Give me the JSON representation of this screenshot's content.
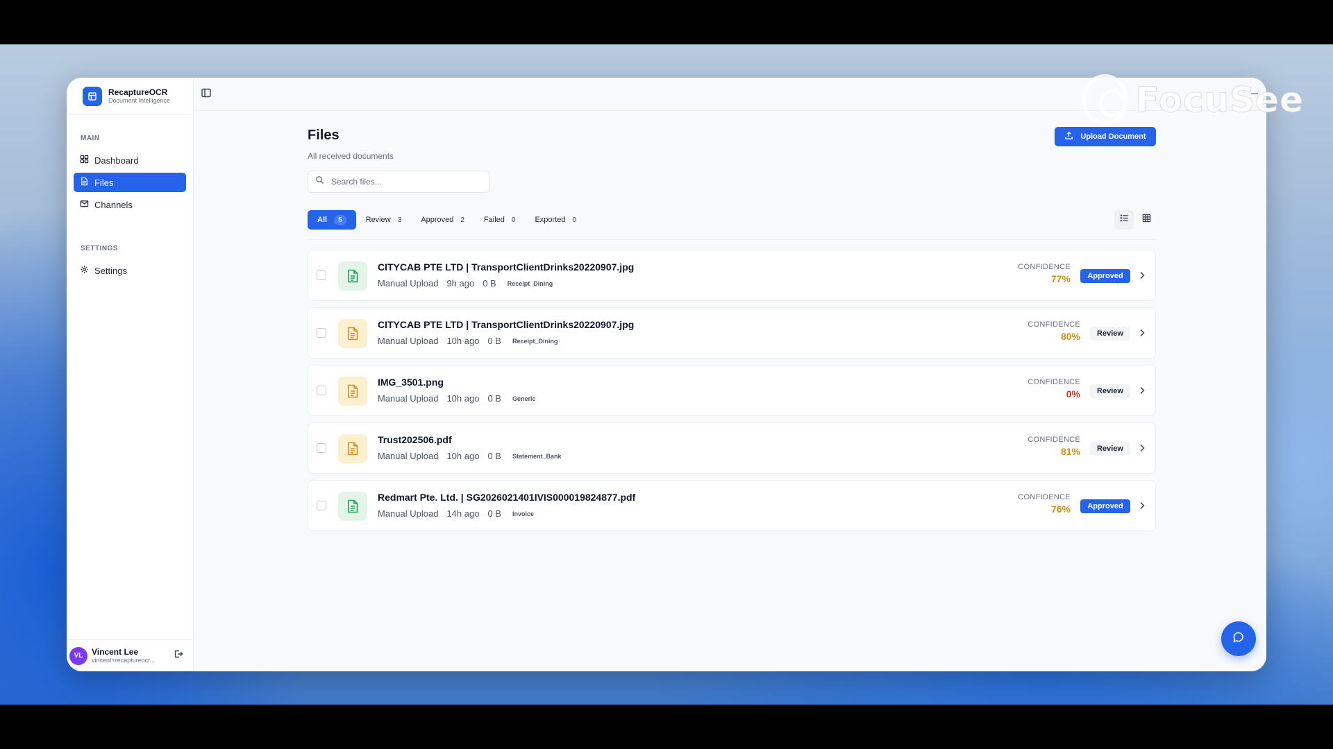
{
  "brand": {
    "name": "RecaptureOCR",
    "subtitle": "Document Intelligence"
  },
  "sidebar": {
    "main_label": "MAIN",
    "main_items": [
      {
        "label": "Dashboard",
        "icon": "grid-icon"
      },
      {
        "label": "Files",
        "icon": "file-icon",
        "active": true
      },
      {
        "label": "Channels",
        "icon": "mail-icon"
      }
    ],
    "settings_label": "SETTINGS",
    "settings_items": [
      {
        "label": "Settings",
        "icon": "gear-icon"
      }
    ]
  },
  "user": {
    "initials": "VL",
    "name": "Vincent Lee",
    "email": "vincent+recaptureocr..."
  },
  "page": {
    "title": "Files",
    "subtitle": "All received documents"
  },
  "toolbar": {
    "upload_label": "Upload Document"
  },
  "search": {
    "placeholder": "Search files..."
  },
  "tabs": [
    {
      "label": "All",
      "count": "5",
      "active": true
    },
    {
      "label": "Review",
      "count": "3"
    },
    {
      "label": "Approved",
      "count": "2"
    },
    {
      "label": "Failed",
      "count": "0"
    },
    {
      "label": "Exported",
      "count": "0"
    }
  ],
  "confidence_label": "CONFIDENCE",
  "files": [
    {
      "name": "CITYCAB PTE LTD | TransportClientDrinks20220907.jpg",
      "source": "Manual Upload",
      "time": "9h ago",
      "size": "0 B",
      "tag": "Receipt_Dining",
      "confidence": "77%",
      "status": "Approved",
      "icon_color": "green"
    },
    {
      "name": "CITYCAB PTE LTD | TransportClientDrinks20220907.jpg",
      "source": "Manual Upload",
      "time": "10h ago",
      "size": "0 B",
      "tag": "Receipt_Dining",
      "confidence": "80%",
      "status": "Review",
      "icon_color": "yellow"
    },
    {
      "name": "IMG_3501.png",
      "source": "Manual Upload",
      "time": "10h ago",
      "size": "0 B",
      "tag": "Generic",
      "confidence": "0%",
      "status": "Review",
      "icon_color": "yellow"
    },
    {
      "name": "Trust202506.pdf",
      "source": "Manual Upload",
      "time": "10h ago",
      "size": "0 B",
      "tag": "Statement_Bank",
      "confidence": "81%",
      "status": "Review",
      "icon_color": "yellow"
    },
    {
      "name": "Redmart Pte. Ltd. | SG2026021401IVIS000019824877.pdf",
      "source": "Manual Upload",
      "time": "14h ago",
      "size": "0 B",
      "tag": "Invoice",
      "confidence": "76%",
      "status": "Approved",
      "icon_color": "green"
    }
  ],
  "watermark": {
    "text": "FocuSee"
  },
  "colors": {
    "accent": "#2563eb",
    "approved": "#2563eb",
    "confidence": "#c9901a",
    "zero_confidence": "#c0392b"
  }
}
